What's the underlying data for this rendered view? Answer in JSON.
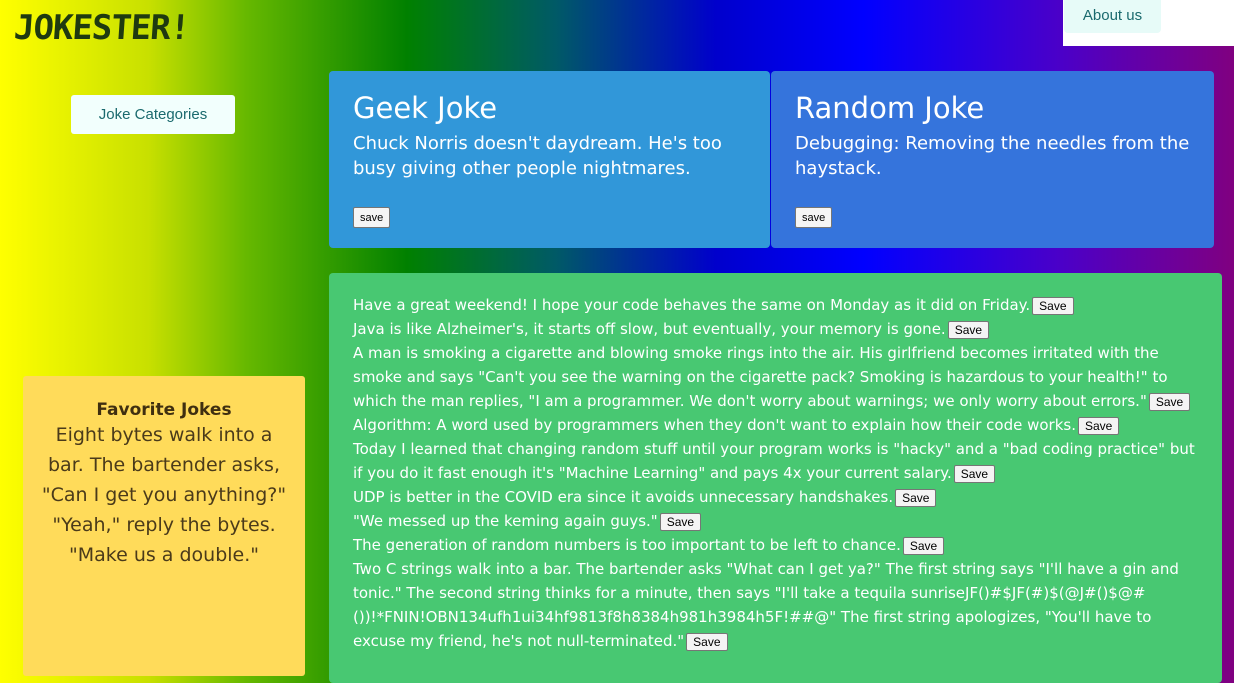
{
  "app": {
    "logo": "JOKESTER!"
  },
  "nav": {
    "about_label": "About us"
  },
  "sidebar": {
    "categories_label": "Joke Categories"
  },
  "cards": [
    {
      "title": "Geek Joke",
      "joke": "Chuck Norris doesn't daydream. He's too busy giving other people nightmares.",
      "save_label": "save"
    },
    {
      "title": "Random Joke",
      "joke": "Debugging: Removing the needles from the haystack.",
      "save_label": "save"
    }
  ],
  "favorites": {
    "title": "Favorite Jokes",
    "joke": "Eight bytes walk into a bar. The bartender asks, \"Can I get you anything?\" \"Yeah,\" reply the bytes. \"Make us a double.\""
  },
  "jokes_list": {
    "save_label": "Save",
    "items": [
      "Have a great weekend! I hope your code behaves the same on Monday as it did on Friday.",
      "Java is like Alzheimer's, it starts off slow, but eventually, your memory is gone.",
      "A man is smoking a cigarette and blowing smoke rings into the air. His girlfriend becomes irritated with the smoke and says \"Can't you see the warning on the cigarette pack? Smoking is hazardous to your health!\" to which the man replies, \"I am a programmer. We don't worry about warnings; we only worry about errors.\"",
      "Algorithm: A word used by programmers when they don't want to explain how their code works.",
      "Today I learned that changing random stuff until your program works is \"hacky\" and a \"bad coding practice\" but if you do it fast enough it's \"Machine Learning\" and pays 4x your current salary.",
      "UDP is better in the COVID era since it avoids unnecessary handshakes.",
      "\"We messed up the keming again guys.\"",
      "The generation of random numbers is too important to be left to chance.",
      "Two C strings walk into a bar. The bartender asks \"What can I get ya?\" The first string says \"I'll have a gin and tonic.\" The second string thinks for a minute, then says \"I'll take a tequila sunriseJF()#$JF(#)$(@J#()$@#())!*FNIN!OBN134ufh1ui34hf9813f8h8384h981h3984h5F!##@\" The first string apologizes, \"You'll have to excuse my friend, he's not null-terminated.\""
    ]
  }
}
